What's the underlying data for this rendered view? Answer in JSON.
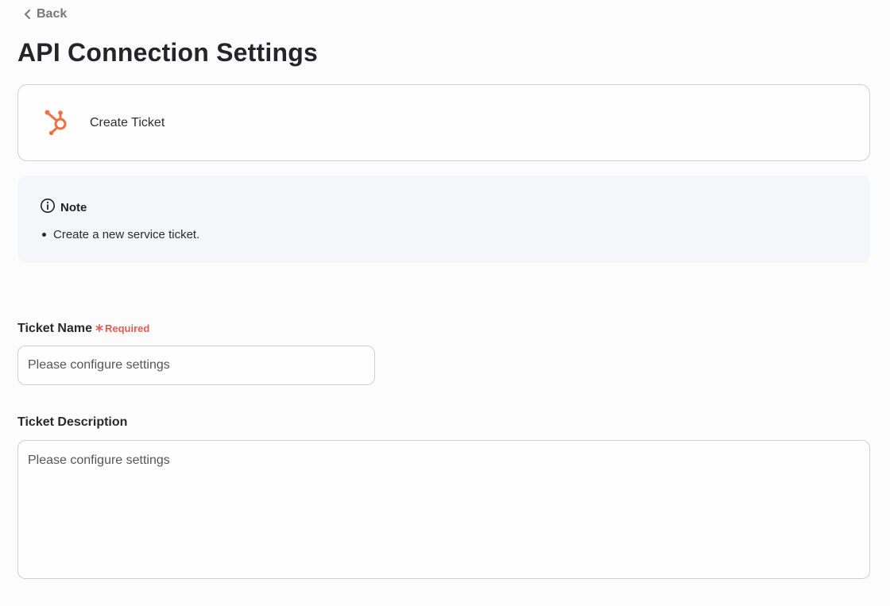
{
  "nav": {
    "back_label": "Back"
  },
  "page": {
    "title": "API Connection Settings"
  },
  "integration": {
    "icon": "hubspot-icon",
    "brand_color": "#f2703f",
    "action_name": "Create Ticket"
  },
  "note": {
    "heading": "Note",
    "items": [
      "Create a new service ticket."
    ]
  },
  "form": {
    "ticket_name": {
      "label": "Ticket Name",
      "required_label": "Required",
      "required_color": "#e45b52",
      "placeholder": "Please configure settings",
      "value": ""
    },
    "ticket_description": {
      "label": "Ticket Description",
      "placeholder": "Please configure settings",
      "value": ""
    }
  }
}
